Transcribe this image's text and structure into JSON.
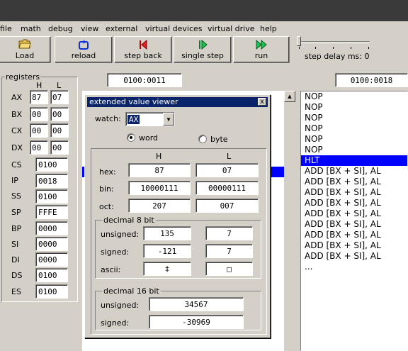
{
  "menu": [
    "file",
    "math",
    "debug",
    "view",
    "external",
    "virtual devices",
    "virtual drive",
    "help"
  ],
  "toolbar": {
    "load": "Load",
    "reload": "reload",
    "step_back": "step back",
    "single_step": "single step",
    "run": "run",
    "step_delay": "step delay ms: 0"
  },
  "addr_left": "0100:0011",
  "addr_right": "0100:0018",
  "registers": {
    "title": "registers",
    "h_label": "H",
    "l_label": "L",
    "split": [
      {
        "name": "AX",
        "h": "87",
        "l": "07"
      },
      {
        "name": "BX",
        "h": "00",
        "l": "00"
      },
      {
        "name": "CX",
        "h": "00",
        "l": "00"
      },
      {
        "name": "DX",
        "h": "00",
        "l": "00"
      }
    ],
    "full": [
      {
        "name": "CS",
        "value": "0100"
      },
      {
        "name": "IP",
        "value": "0018"
      },
      {
        "name": "SS",
        "value": "0100"
      },
      {
        "name": "SP",
        "value": "FFFE"
      },
      {
        "name": "BP",
        "value": "0000"
      },
      {
        "name": "SI",
        "value": "0000"
      },
      {
        "name": "DI",
        "value": "0000"
      },
      {
        "name": "DS",
        "value": "0100"
      },
      {
        "name": "ES",
        "value": "0100"
      }
    ]
  },
  "disasm": [
    "NOP",
    "NOP",
    "NOP",
    "NOP",
    "NOP",
    "NOP",
    "HLT",
    "ADD [BX + SI], AL",
    "ADD [BX + SI], AL",
    "ADD [BX + SI], AL",
    "ADD [BX + SI], AL",
    "ADD [BX + SI], AL",
    "ADD [BX + SI], AL",
    "ADD [BX + SI], AL",
    "ADD [BX + SI], AL",
    "ADD [BX + SI], AL",
    "..."
  ],
  "disasm_selected_index": 6,
  "viewer": {
    "title": "extended value viewer",
    "close": "x",
    "watch_label": "watch:",
    "watch_value": "AX",
    "radio_word": "word",
    "radio_byte": "byte",
    "selected_mode": "word",
    "col_h": "H",
    "col_l": "L",
    "hex_label": "hex:",
    "bin_label": "bin:",
    "oct_label": "oct:",
    "hex_h": "87",
    "hex_l": "07",
    "bin_h": "10000111",
    "bin_l": "00000111",
    "oct_h": "207",
    "oct_l": "007",
    "dec8_title": "decimal 8 bit",
    "unsigned_label": "unsigned:",
    "signed_label": "signed:",
    "ascii_label": "ascii:",
    "unsigned_h": "135",
    "unsigned_l": "7",
    "signed_h": "-121",
    "signed_l": "7",
    "ascii_h": "‡",
    "ascii_l": "□",
    "dec16_title": "decimal 16 bit",
    "unsigned16": "34567",
    "signed16": "-30969"
  },
  "colors": {
    "selection": "#0000ff",
    "title_active": "#0a246a"
  }
}
